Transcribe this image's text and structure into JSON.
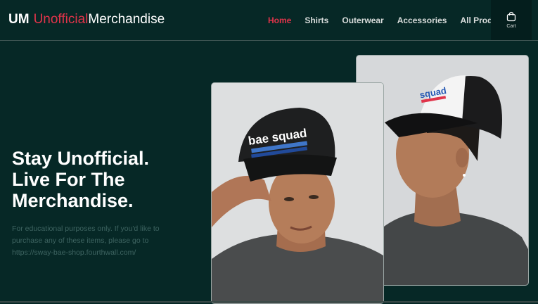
{
  "brand": {
    "abbr": "UM",
    "part1": "Unofficial",
    "part2": "Merchandise"
  },
  "nav": {
    "items": [
      {
        "label": "Home",
        "active": true
      },
      {
        "label": "Shirts",
        "active": false
      },
      {
        "label": "Outerwear",
        "active": false
      },
      {
        "label": "Accessories",
        "active": false
      },
      {
        "label": "All Products",
        "active": false
      }
    ]
  },
  "cart": {
    "label": "Cart",
    "icon": "shopping-bag-icon"
  },
  "hero": {
    "title_lines": [
      "Stay Unofficial.",
      "Live For The",
      "Merchandise."
    ],
    "note": "For educational purposes only. If you'd like to purchase any of these items, please go to https://sway-bae-shop.fourthwall.com/"
  },
  "images": {
    "front_cap": {
      "logo_text": "bae squad"
    },
    "back_cap": {
      "logo_text": "squad"
    }
  },
  "colors": {
    "background": "#062826",
    "accent": "#e0344a",
    "nav_text": "#d8dcdb",
    "muted_text": "#3e6461"
  }
}
